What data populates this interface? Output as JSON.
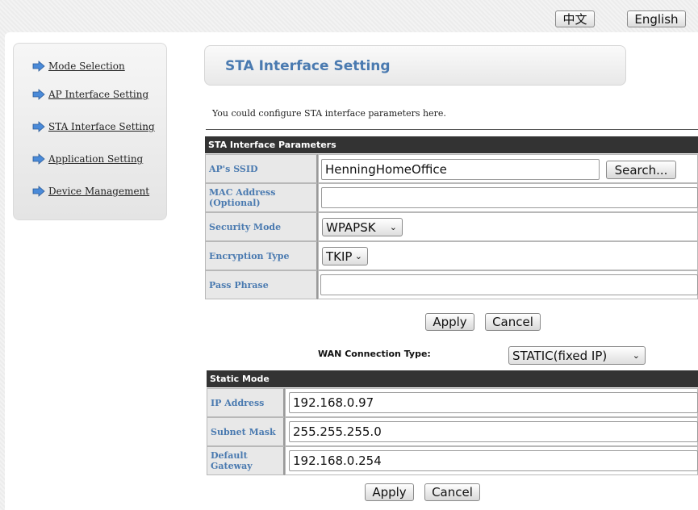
{
  "language": {
    "zh": "中文",
    "en": "English"
  },
  "sidebar": {
    "items": [
      {
        "label": "Mode Selection"
      },
      {
        "label": "AP Interface Setting"
      },
      {
        "label": "STA Interface Setting"
      },
      {
        "label": "Application Setting"
      },
      {
        "label": "Device Management"
      }
    ]
  },
  "page": {
    "title": "STA Interface Setting",
    "intro": "You could configure STA interface parameters here."
  },
  "sta": {
    "header": "STA Interface Parameters",
    "ssid_label": "AP's SSID",
    "ssid_value": "HenningHomeOffice",
    "search_label": "Search...",
    "mac_label": "MAC Address (Optional)",
    "mac_value": "",
    "security_label": "Security Mode",
    "security_value": "WPAPSK",
    "encryption_label": "Encryption Type",
    "encryption_value": "TKIP",
    "passphrase_label": "Pass Phrase",
    "passphrase_value": "",
    "apply_label": "Apply",
    "cancel_label": "Cancel"
  },
  "wan": {
    "type_label": "WAN Connection Type:",
    "type_value": "STATIC(fixed IP)",
    "header": "Static Mode",
    "ip_label": "IP Address",
    "ip_value": "192.168.0.97",
    "mask_label": "Subnet Mask",
    "mask_value": "255.255.255.0",
    "gateway_label": "Default Gateway",
    "gateway_value": "192.168.0.254",
    "apply_label": "Apply",
    "cancel_label": "Cancel"
  },
  "colors": {
    "accent": "#4a7ab0",
    "header_bg": "#333333",
    "nav_arrow": "#4a8ad8"
  }
}
